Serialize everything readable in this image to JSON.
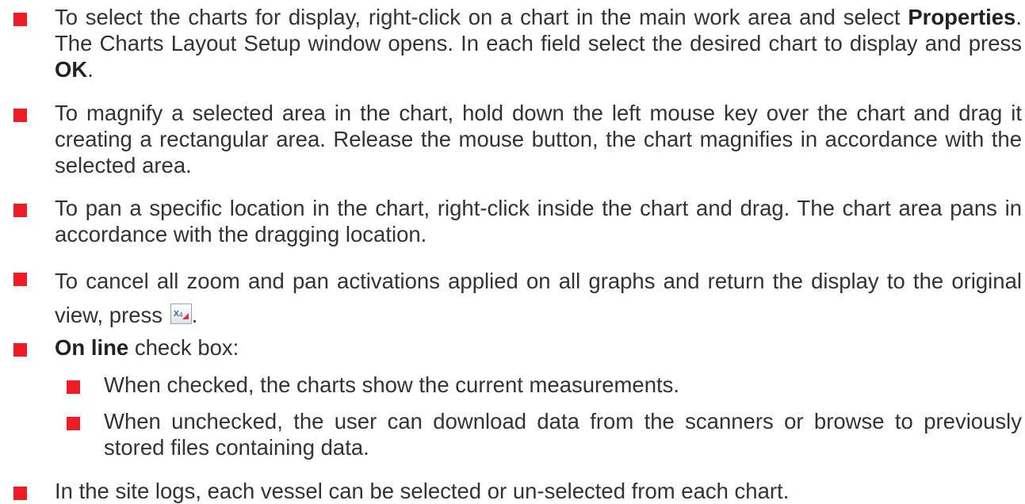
{
  "bullet_color": "#ee1c24",
  "items": [
    {
      "t1": "To select the charts for display, right-click on a chart in the main work area and select ",
      "b1": "Properties",
      "t2": ". The Charts Layout Setup window opens. In each field select the desired chart to display and press ",
      "b2": "OK",
      "t3": "."
    },
    {
      "text": "To magnify a selected area in the chart, hold down the left mouse key over the chart and drag it creating a rectangular area. Release the mouse button, the chart magnifies in accordance with the selected area."
    },
    {
      "text": "To pan a specific location in the chart, right-click inside the chart and drag. The chart area pans in accordance with the dragging location."
    },
    {
      "text": "To cancel all zoom and pan activations applied on all graphs and return the display to the original view, press ",
      "icon": "reset-zoom-icon",
      "tail": "."
    },
    {
      "bold": "On line",
      "text": " check box:",
      "subitems": [
        "When checked, the charts show the current measurements.",
        "When unchecked, the user can download data from the scanners or browse to previously stored files containing data."
      ]
    },
    {
      "text": "In the site logs, each vessel can be selected or un-selected from each chart."
    }
  ]
}
